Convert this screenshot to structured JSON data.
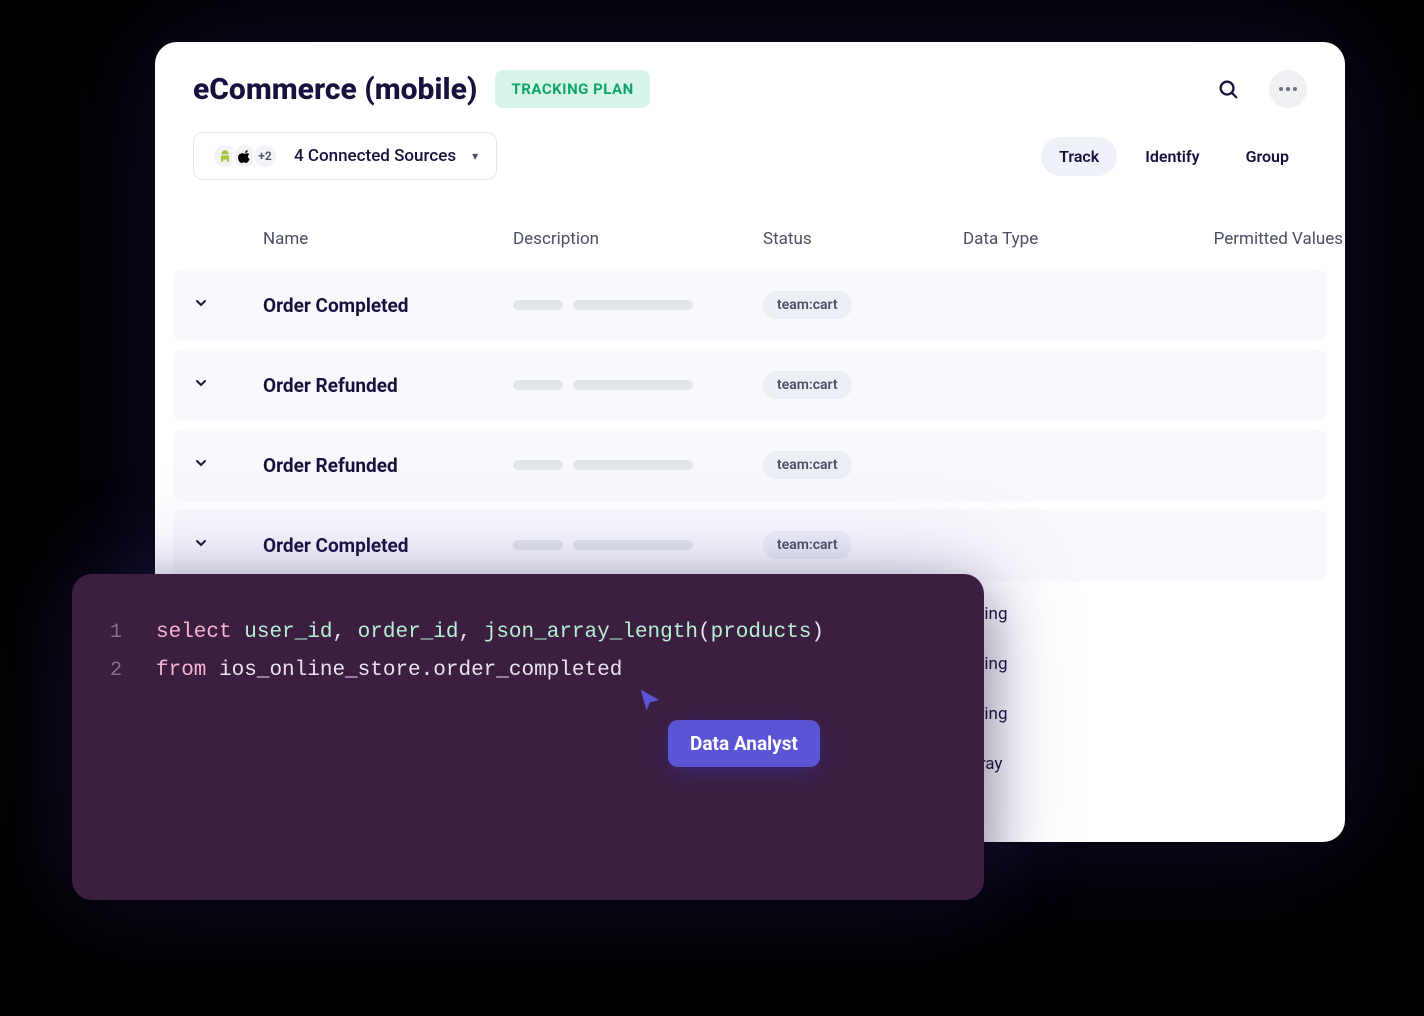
{
  "header": {
    "title": "eCommerce (mobile)",
    "badge": "TRACKING PLAN"
  },
  "sources": {
    "extra_count": "+2",
    "label": "4 Connected Sources"
  },
  "tabs": {
    "track": "Track",
    "identify": "Identify",
    "group": "Group"
  },
  "columns": {
    "name": "Name",
    "description": "Description",
    "status": "Status",
    "data_type": "Data Type",
    "permitted": "Permitted Values"
  },
  "rows": [
    {
      "name": "Order Completed",
      "status": "team:cart",
      "show_more": true
    },
    {
      "name": "Order Refunded",
      "status": "team:cart",
      "show_more": true
    },
    {
      "name": "Order Refunded",
      "status": "team:cart",
      "show_more": true
    },
    {
      "name": "Order Completed",
      "status": "team:cart",
      "show_more": false
    }
  ],
  "data_types": [
    "String",
    "String",
    "String",
    "Array"
  ],
  "code": {
    "lines": [
      {
        "n": "1",
        "tokens": [
          "select",
          "user_id",
          ",",
          "order_id",
          ",",
          "json_array_length",
          "(",
          "products",
          ")"
        ]
      },
      {
        "n": "2",
        "tokens": [
          "from",
          "ios_online_store.order_completed"
        ]
      }
    ]
  },
  "cursor": {
    "label": "Data Analyst"
  }
}
